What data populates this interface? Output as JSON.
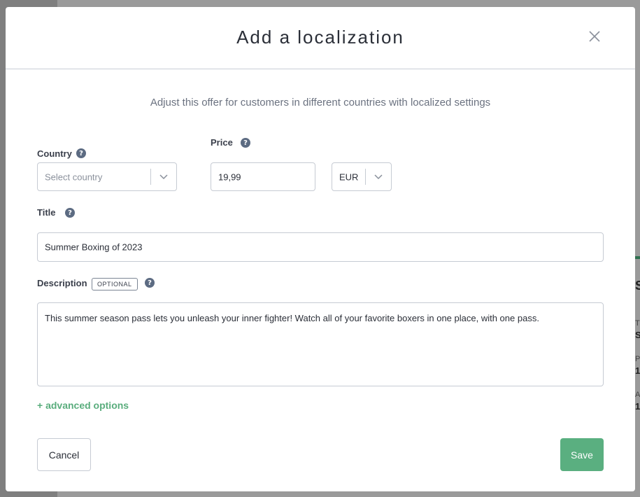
{
  "modal": {
    "title": "Add a localization",
    "subtitle": "Adjust this offer for customers in different countries with localized settings"
  },
  "country": {
    "label": "Country",
    "placeholder": "Select country"
  },
  "price": {
    "label": "Price",
    "value": "19,99",
    "currency": "EUR"
  },
  "title_field": {
    "label": "Title",
    "value": "Summer Boxing of 2023"
  },
  "description": {
    "label": "Description",
    "badge": "OPTIONAL",
    "value": "This summer season pass lets you unleash your inner fighter! Watch all of your favorite boxers in one place, with one pass."
  },
  "advanced_link": "+ advanced options",
  "buttons": {
    "cancel": "Cancel",
    "save": "Save"
  },
  "help_glyph": "?",
  "colors": {
    "accent_green": "#5aaf80",
    "link_green": "#5aad7d",
    "help_icon": "#5c6b82"
  },
  "background": {
    "letters": [
      "S",
      "T",
      "S",
      "P",
      "1",
      "A",
      "1"
    ]
  }
}
